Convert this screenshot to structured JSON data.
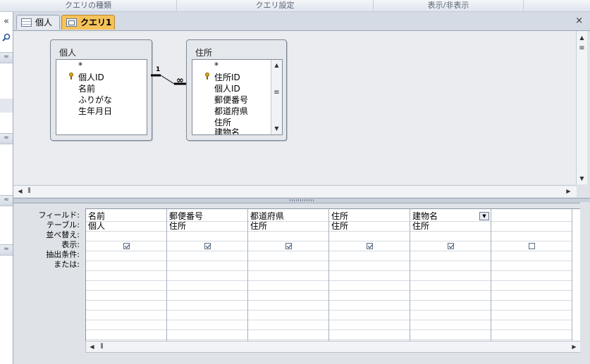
{
  "ribbon": {
    "groups": [
      "クエリの種類",
      "クエリ設定",
      "表示/非表示"
    ]
  },
  "nav": {
    "collapse_glyph": "«",
    "band_glyph": "≈"
  },
  "tabs": [
    {
      "label": "個人",
      "icon": "table-icon",
      "active": false
    },
    {
      "label": "クエリ1",
      "icon": "query-icon",
      "active": true
    }
  ],
  "tab_close_glyph": "×",
  "design": {
    "tables": [
      {
        "name": "個人",
        "fields": [
          "*",
          "個人ID",
          "名前",
          "ふりがな",
          "生年月日"
        ],
        "key_field": "個人ID"
      },
      {
        "name": "住所",
        "fields": [
          "*",
          "住所ID",
          "個人ID",
          "郵便番号",
          "都道府県",
          "住所",
          "建物名"
        ],
        "key_field": "住所ID"
      }
    ],
    "relationship": {
      "one_side": "1",
      "many_side": "∞"
    }
  },
  "grid": {
    "row_labels": [
      "フィールド:",
      "テーブル:",
      "並べ替え:",
      "表示:",
      "抽出条件:",
      "または:"
    ],
    "columns": [
      {
        "field": "名前",
        "table": "個人",
        "show": true
      },
      {
        "field": "郵便番号",
        "table": "住所",
        "show": true
      },
      {
        "field": "都道府県",
        "table": "住所",
        "show": true
      },
      {
        "field": "住所",
        "table": "住所",
        "show": true
      },
      {
        "field": "建物名",
        "table": "住所",
        "show": true,
        "has_dropdown": true
      },
      {
        "field": "",
        "table": "",
        "show": false
      }
    ]
  },
  "colors": {
    "accent_tab": "#f5c25a",
    "background": "#dfe3e8"
  }
}
